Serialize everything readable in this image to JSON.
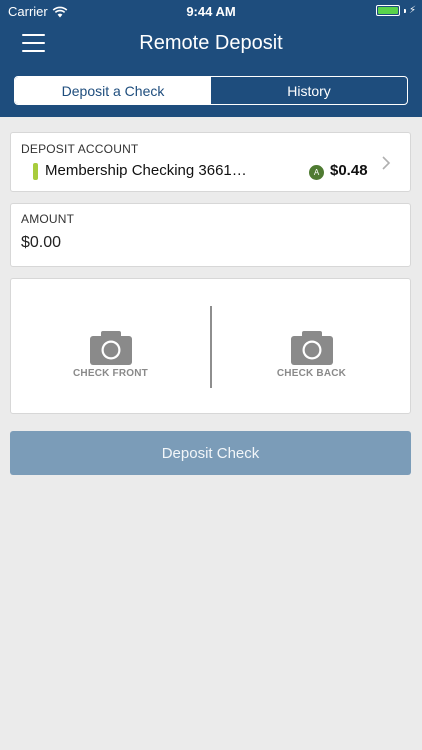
{
  "status_bar": {
    "carrier": "Carrier",
    "time": "9:44 AM",
    "wifi_icon": "wifi-icon",
    "battery_icon": "battery-full-icon"
  },
  "nav": {
    "title": "Remote Deposit",
    "menu_icon": "hamburger-menu-icon"
  },
  "tabs": [
    {
      "label": "Deposit a Check",
      "active": true
    },
    {
      "label": "History",
      "active": false
    }
  ],
  "deposit_account": {
    "label": "DEPOSIT ACCOUNT",
    "account_name": "Membership Checking 3661…",
    "badge": "A",
    "balance": "$0.48",
    "indicator_color": "#a8cc3d"
  },
  "amount": {
    "label": "AMOUNT",
    "value": "$0.00"
  },
  "check_images": {
    "front_label": "CHECK FRONT",
    "back_label": "CHECK BACK",
    "icon": "camera-icon"
  },
  "deposit_button": {
    "label": "Deposit Check"
  },
  "colors": {
    "header_bg": "#1e4d7d",
    "page_bg": "#ebebeb",
    "button_bg": "#7b9cb8",
    "badge_bg": "#4f7b32"
  }
}
